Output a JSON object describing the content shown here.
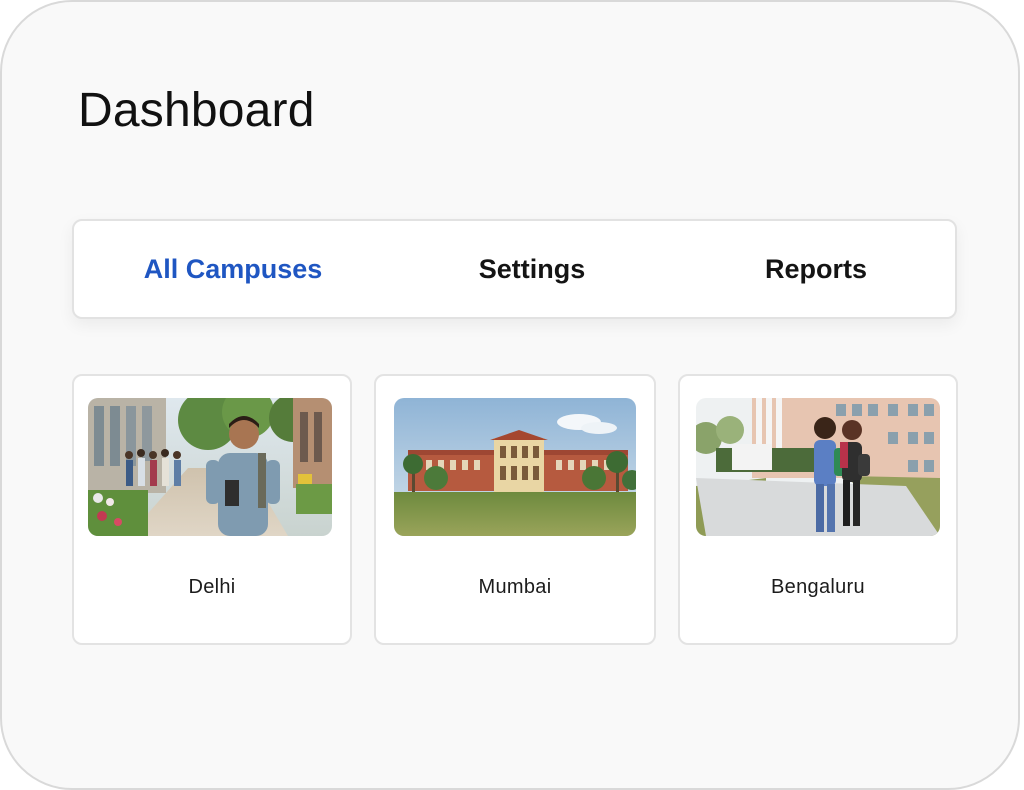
{
  "header": {
    "title": "Dashboard"
  },
  "tabs": [
    {
      "label": "All Campuses",
      "active": true
    },
    {
      "label": "Settings",
      "active": false
    },
    {
      "label": "Reports",
      "active": false
    }
  ],
  "campuses": [
    {
      "name": "Delhi",
      "image": "campus-courtyard-students-photo"
    },
    {
      "name": "Mumbai",
      "image": "heritage-building-lawn-photo"
    },
    {
      "name": "Bengaluru",
      "image": "students-walking-campus-photo"
    }
  ],
  "colors": {
    "accent": "#1f56c2",
    "background": "#f9f9f9",
    "card": "#ffffff",
    "border": "#e3e3e3"
  }
}
